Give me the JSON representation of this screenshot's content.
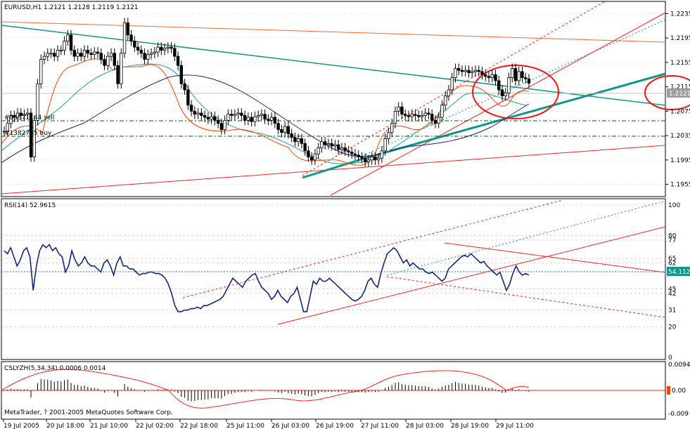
{
  "chart_data": [
    {
      "type": "candlestick",
      "title": "EURUSD,H1  1.2121 1.2128 1.2119 1.2121",
      "ylim": [
        1.1935,
        1.2255
      ],
      "y_ticks": [
        "1.2235",
        "1.2195",
        "1.2155",
        "1.2115",
        "1.2075",
        "1.2035",
        "1.1995",
        "1.1955"
      ],
      "current_price_label": "1.2121",
      "order_labels": [
        "#86571144 sell",
        "#1382705 buy"
      ],
      "close": [
        1.2042,
        1.2055,
        1.2068,
        1.2065,
        1.2072,
        1.2068,
        1.207,
        1.2072,
        1.2,
        1.206,
        1.212,
        1.216,
        1.2165,
        1.217,
        1.217,
        1.2165,
        1.2175,
        1.2175,
        1.219,
        1.22,
        1.2175,
        1.2165,
        1.217,
        1.2165,
        1.2175,
        1.217,
        1.2168,
        1.2172,
        1.217,
        1.216,
        1.215,
        1.2165,
        1.217,
        1.215,
        1.212,
        1.217,
        1.222,
        1.22,
        1.219,
        1.218,
        1.2175,
        1.217,
        1.216,
        1.2168,
        1.217,
        1.2172,
        1.218,
        1.2175,
        1.2178,
        1.218,
        1.2178,
        1.2165,
        1.215,
        1.212,
        1.211,
        1.2085,
        1.2075,
        1.207,
        1.2072,
        1.2068,
        1.2065,
        1.2062,
        1.2066,
        1.206,
        1.2055,
        1.2045,
        1.206,
        1.207,
        1.2068,
        1.207,
        1.2072,
        1.2068,
        1.206,
        1.2065,
        1.2058,
        1.2066,
        1.2068,
        1.207,
        1.2062,
        1.206,
        1.2065,
        1.2055,
        1.2045,
        1.204,
        1.205,
        1.2038,
        1.2032,
        1.2025,
        1.203,
        1.2022,
        1.201,
        1.2,
        1.1995,
        1.2005,
        1.2015,
        1.2025,
        1.202,
        1.2022,
        1.2018,
        1.202,
        1.2012,
        1.2015,
        1.201,
        1.2008,
        1.2005,
        1.2003,
        1.2,
        1.1998,
        1.1992,
        1.1995,
        1.2,
        1.1995,
        1.1998,
        1.201,
        1.203,
        1.204,
        1.2055,
        1.2075,
        1.2082,
        1.207,
        1.2068,
        1.2066,
        1.207,
        1.2068,
        1.2066,
        1.2068,
        1.2072,
        1.207,
        1.206,
        1.2055,
        1.2065,
        1.2085,
        1.21,
        1.211,
        1.213,
        1.2145,
        1.2142,
        1.214,
        1.2142,
        1.2138,
        1.214,
        1.2142,
        1.214,
        1.2135,
        1.2132,
        1.213,
        1.2135,
        1.2125,
        1.211,
        1.21,
        1.2105,
        1.213,
        1.2145,
        1.2125,
        1.214,
        1.213,
        1.2128,
        1.2121
      ]
    },
    {
      "type": "line",
      "title": "RSI(14) 52.9615",
      "ylim": [
        0,
        100
      ],
      "y_ticks": [
        "100",
        "80",
        "77",
        "65",
        "62",
        "45",
        "42",
        "31",
        "20",
        "0"
      ],
      "current_value_label": "54.1128",
      "values": [
        70,
        68,
        72,
        66,
        60,
        64,
        70,
        72,
        66,
        44,
        60,
        70,
        74,
        72,
        74,
        70,
        72,
        68,
        66,
        56,
        60,
        70,
        64,
        60,
        62,
        66,
        62,
        60,
        60,
        58,
        56,
        62,
        64,
        60,
        54,
        62,
        66,
        60,
        60,
        58,
        58,
        56,
        54,
        55,
        55,
        56,
        56,
        55,
        55,
        54,
        52,
        48,
        42,
        34,
        30,
        30,
        31,
        31,
        32,
        32,
        33,
        32,
        34,
        34,
        35,
        36,
        37,
        38,
        40,
        44,
        48,
        52,
        50,
        48,
        46,
        50,
        52,
        54,
        55,
        50,
        46,
        44,
        42,
        38,
        40,
        44,
        40,
        38,
        36,
        40,
        42,
        46,
        38,
        30,
        30,
        40,
        50,
        48,
        52,
        50,
        50,
        52,
        50,
        48,
        46,
        44,
        42,
        40,
        38,
        37,
        38,
        40,
        44,
        50,
        52,
        48,
        46,
        55,
        62,
        68,
        70,
        72,
        70,
        66,
        62,
        64,
        60,
        62,
        60,
        58,
        58,
        56,
        55,
        56,
        54,
        52,
        50,
        52,
        58,
        60,
        62,
        64,
        66,
        67,
        66,
        68,
        66,
        64,
        62,
        63,
        60,
        58,
        56,
        54,
        56,
        50,
        44,
        48,
        55,
        60,
        56,
        54,
        55,
        54
      ]
    },
    {
      "type": "bar",
      "title": "CSLYZH(5,34,34) 0.0006 0.0014",
      "ylim": [
        -0.0014,
        0.0014
      ],
      "y_ticks": [
        "0.0094",
        "0.00",
        "-0.009"
      ]
    }
  ],
  "x_labels": [
    "19 Jul 2005",
    "20 Jul 18:00",
    "21 Jul 10:00",
    "22 Jul 02:00",
    "22 Jul 18:00",
    "25 Jul 11:00",
    "26 Jul 03:00",
    "26 Jul 19:00",
    "27 Jul 11:00",
    "28 Jul 03:00",
    "28 Jul 19:00",
    "29 Jul 11:00"
  ],
  "footer": "MetaTrader, ? 2001-2005 MetaQuotes Software Corp.",
  "colors": {
    "bull": "#000000",
    "bear": "#000000",
    "ma_fast": "#ff4400",
    "ma_mid": "#20a090",
    "ma_slow": "#1a237e",
    "rsi": "#1a237e",
    "trend_red": "#ff2020",
    "trend_teal": "#119688",
    "grid": "#c0c0c0",
    "level": "#006600"
  }
}
